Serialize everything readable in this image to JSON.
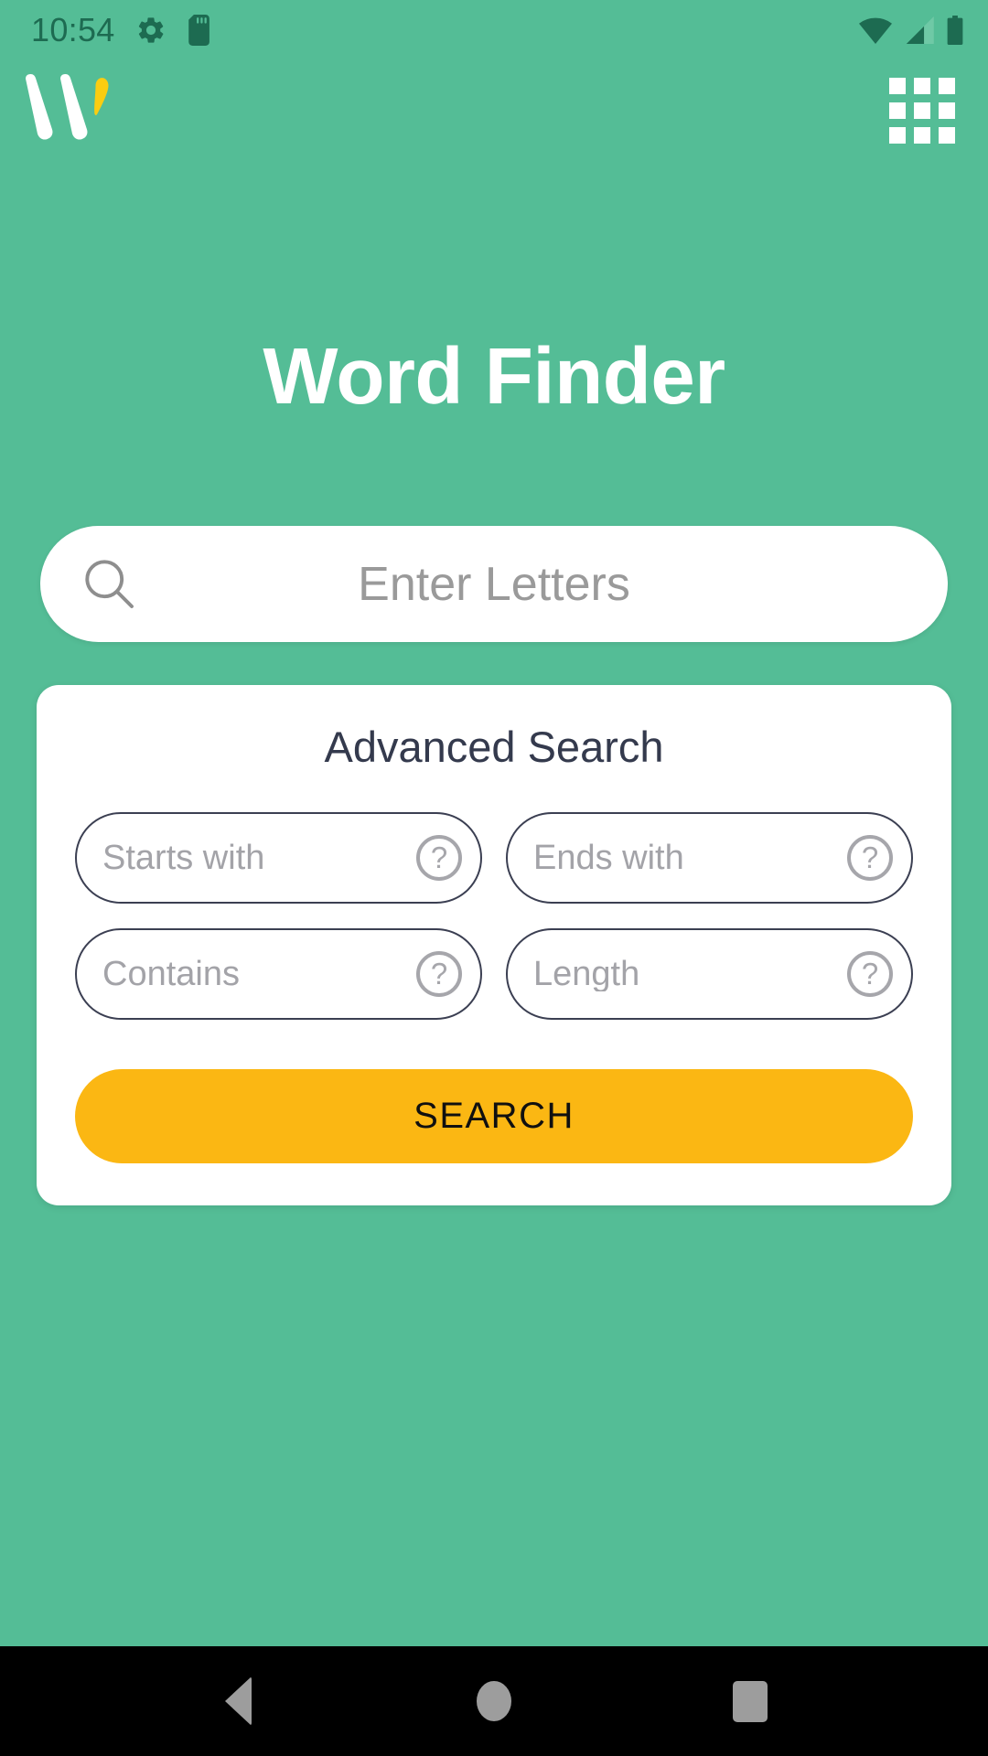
{
  "theme": {
    "background_green": "#54bd96",
    "accent_yellow": "#fbb713",
    "logo_yellow": "#fbcd10",
    "card_white": "#ffffff",
    "heading_navy": "#343a4d",
    "placeholder_grey": "#a3a3a8",
    "navbar_black": "#000000"
  },
  "status_bar": {
    "clock": "10:54",
    "left_icons": [
      {
        "name": "settings-gear-icon",
        "label": "Settings"
      },
      {
        "name": "sd-card-icon",
        "label": "SD Card"
      }
    ],
    "right_icons": [
      {
        "name": "wifi-icon",
        "label": "Wi-Fi"
      },
      {
        "name": "cellular-signal-icon",
        "label": "Mobile signal"
      },
      {
        "name": "battery-icon",
        "label": "Battery"
      }
    ]
  },
  "app_bar": {
    "logo_name": "word-finder-logo",
    "logo_alt": "W",
    "menu_name": "grid-menu-icon",
    "menu_label": "Apps"
  },
  "header": {
    "title": "Word Finder"
  },
  "search": {
    "icon_name": "search-icon",
    "placeholder": "Enter Letters",
    "value": ""
  },
  "advanced": {
    "title": "Advanced Search",
    "fields": [
      {
        "key": "starts_with",
        "placeholder": "Starts with",
        "value": "",
        "help_glyph": "?"
      },
      {
        "key": "ends_with",
        "placeholder": "Ends with",
        "value": "",
        "help_glyph": "?"
      },
      {
        "key": "contains",
        "placeholder": "Contains",
        "value": "",
        "help_glyph": "?"
      },
      {
        "key": "length",
        "placeholder": "Length",
        "value": "",
        "help_glyph": "?"
      }
    ],
    "search_button_label": "SEARCH"
  },
  "nav_bar": {
    "buttons": [
      {
        "name": "nav-back-button",
        "label": "Back"
      },
      {
        "name": "nav-home-button",
        "label": "Home"
      },
      {
        "name": "nav-recents-button",
        "label": "Recent apps"
      }
    ]
  }
}
